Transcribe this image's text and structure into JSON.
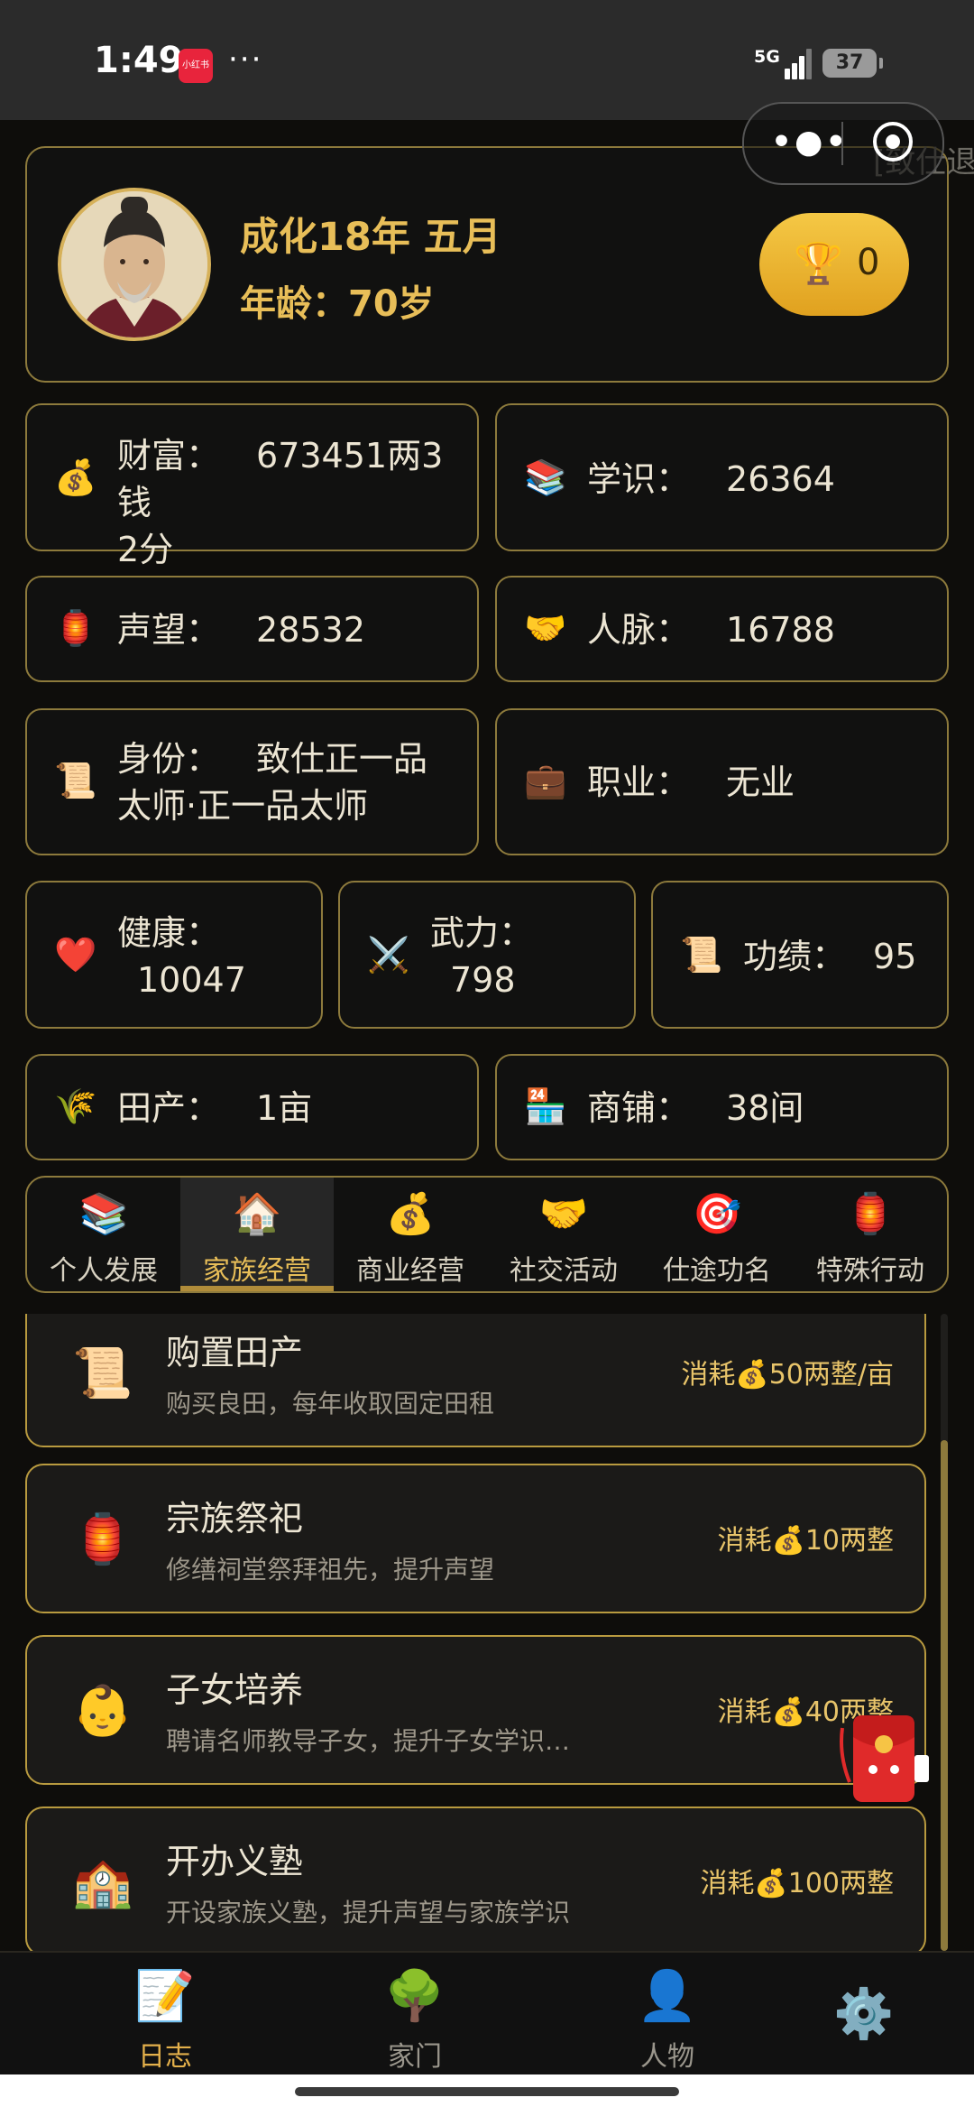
{
  "status_bar": {
    "time": "1:49",
    "app_badge": "小红书",
    "more": "···",
    "network": "5G",
    "battery": "37"
  },
  "capsule": {
    "more_icon": "more-dots-icon",
    "close_icon": "target-icon"
  },
  "resign_tag": "[致仕退",
  "header": {
    "date": "成化18年 五月",
    "age_label": "年龄：",
    "age_value": "70岁",
    "trophy_count": "0"
  },
  "stats": {
    "wealth": {
      "label": "财富：",
      "value": "673451两3钱",
      "value2": "2分",
      "icon": "money-bag-icon"
    },
    "knowledge": {
      "label": "学识：",
      "value": "26364",
      "icon": "books-icon"
    },
    "prestige": {
      "label": "声望：",
      "value": "28532",
      "icon": "lantern-icon"
    },
    "network": {
      "label": "人脉：",
      "value": "16788",
      "icon": "handshake-icon"
    },
    "identity": {
      "label": "身份：",
      "value": "致仕正一品",
      "value2": "太师·正一品太师",
      "icon": "scroll-icon"
    },
    "occupation": {
      "label": "职业：",
      "value": "无业",
      "icon": "briefcase-icon"
    },
    "health": {
      "label": "健康：",
      "value": "10047",
      "icon": "heart-icon"
    },
    "martial": {
      "label": "武力：",
      "value": "798",
      "icon": "swords-icon"
    },
    "merit": {
      "label": "功绩：",
      "value": "95",
      "icon": "scroll-icon"
    },
    "fields": {
      "label": "田产：",
      "value": "1亩",
      "icon": "rice-icon"
    },
    "shops": {
      "label": "商铺：",
      "value": "38间",
      "icon": "store-icon"
    }
  },
  "tabs": [
    {
      "label": "个人发展",
      "icon": "books-icon"
    },
    {
      "label": "家族经营",
      "icon": "house-icon",
      "active": true
    },
    {
      "label": "商业经营",
      "icon": "money-bag-icon"
    },
    {
      "label": "社交活动",
      "icon": "handshake-icon"
    },
    {
      "label": "仕途功名",
      "icon": "target-icon"
    },
    {
      "label": "特殊行动",
      "icon": "lantern-icon"
    }
  ],
  "actions": [
    {
      "title": "购置田产",
      "desc": "购买良田，每年收取固定田租",
      "cost": "消耗💰50两整/亩",
      "icon": "scroll-icon"
    },
    {
      "title": "宗族祭祀",
      "desc": "修缮祠堂祭拜祖先，提升声望",
      "cost": "消耗💰10两整",
      "icon": "lantern-icon"
    },
    {
      "title": "子女培养",
      "desc": "聘请名师教导子女，提升子女学识…",
      "cost": "消耗💰40两整",
      "icon": "baby-icon"
    },
    {
      "title": "开办义塾",
      "desc": "开设家族义塾，提升声望与家族学识",
      "cost": "消耗💰100两整",
      "icon": "school-icon"
    }
  ],
  "bottom_nav": [
    {
      "label": "日志",
      "icon": "memo-icon",
      "active": true
    },
    {
      "label": "家门",
      "icon": "tree-icon"
    },
    {
      "label": "人物",
      "icon": "person-icon"
    },
    {
      "label": "",
      "icon": "gear-icon"
    }
  ],
  "colors": {
    "gold": "#e8be58",
    "border": "#8d7a3c",
    "background": "#0e0d0b"
  }
}
